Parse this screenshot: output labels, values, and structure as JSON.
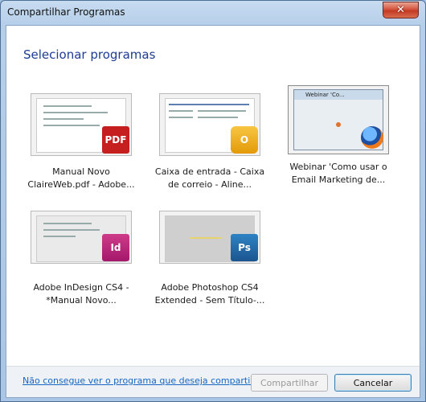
{
  "window": {
    "title": "Compartilhar Programas"
  },
  "heading": "Selecionar programas",
  "programs": [
    {
      "label_line1": "Manual Novo",
      "label_line2": "ClaireWeb.pdf - Adobe...",
      "badge": "PDF",
      "badge_text": "Adobe"
    },
    {
      "label_line1": "Caixa de entrada - Caixa",
      "label_line2": "de correio - Aline...",
      "badge": "O"
    },
    {
      "label_line1": "Webinar 'Como usar o",
      "label_line2": "Email Marketing de...",
      "mini_title": "Webinar 'Co..."
    },
    {
      "label_line1": "Adobe InDesign CS4 -",
      "label_line2": "*Manual Novo...",
      "badge": "Id"
    },
    {
      "label_line1": "Adobe Photoshop CS4",
      "label_line2": "Extended - Sem Título-...",
      "badge": "Ps"
    }
  ],
  "footer": {
    "link": "Não consegue ver o programa que deseja compartilh...",
    "share_button": "Compartilhar",
    "cancel_button": "Cancelar"
  },
  "colors": {
    "heading": "#1e3c96",
    "link": "#1766c2",
    "close": "#c33a22"
  }
}
